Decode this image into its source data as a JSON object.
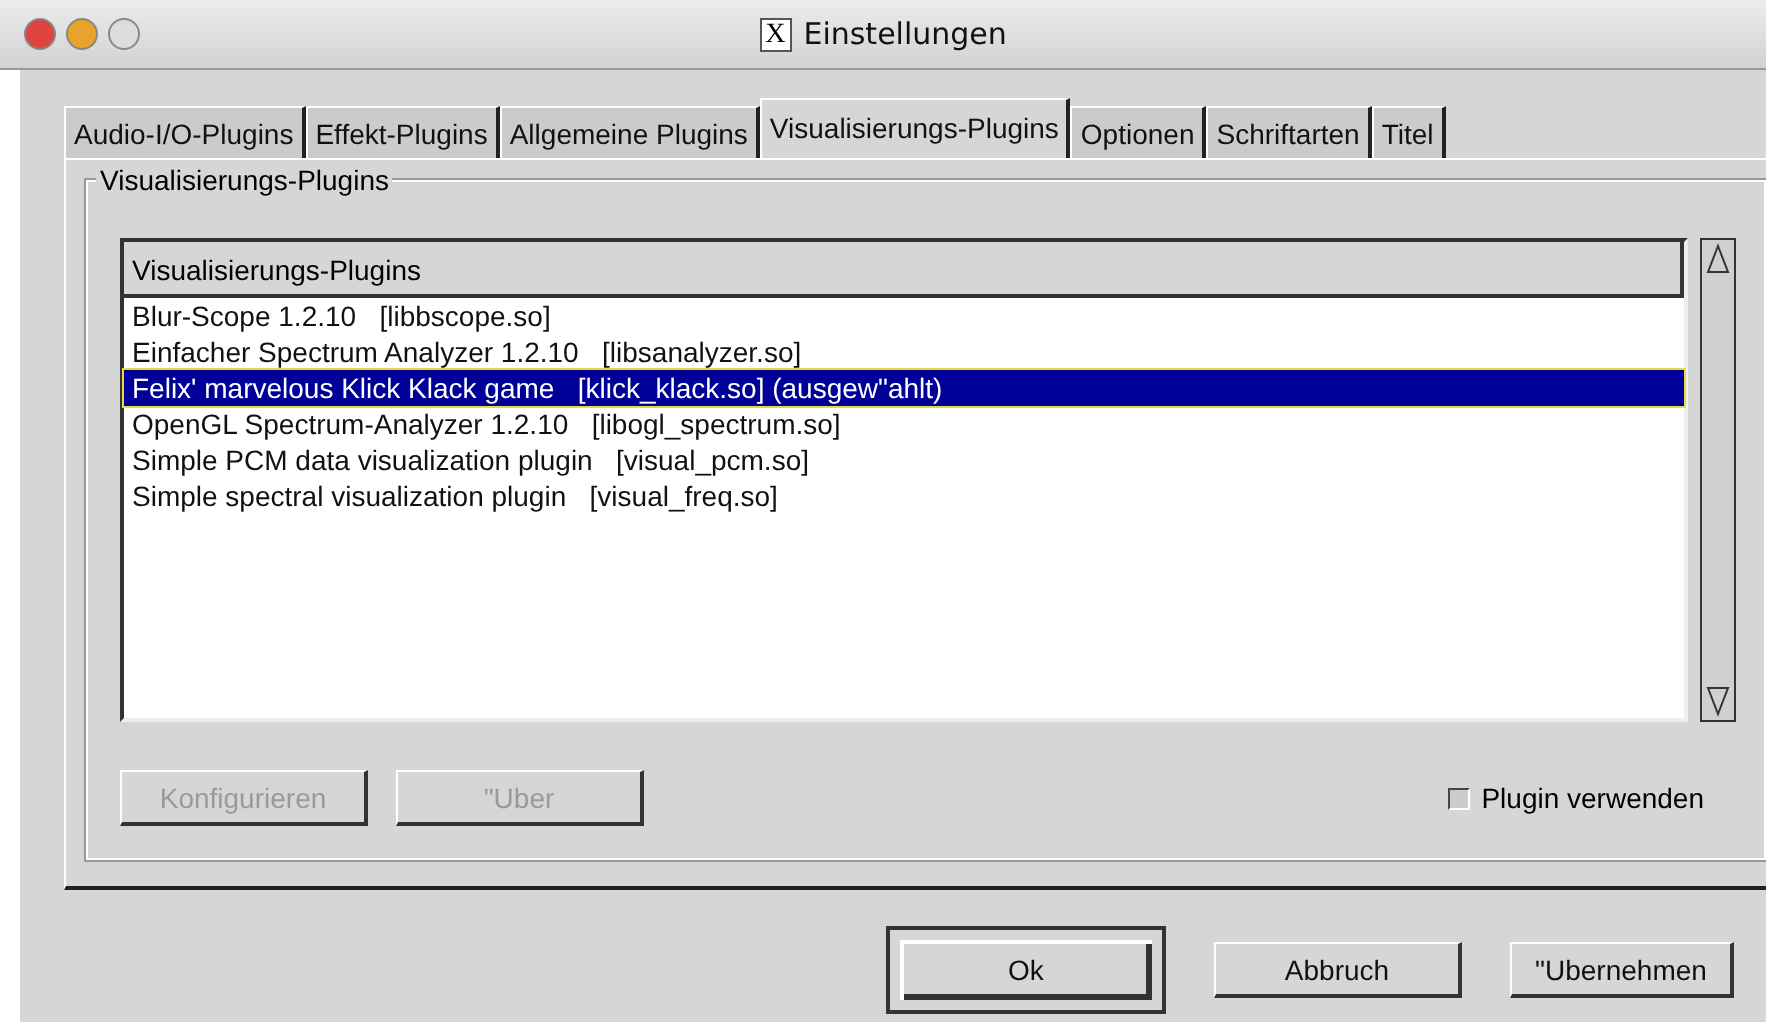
{
  "window": {
    "title": "Einstellungen",
    "title_glyph": "X"
  },
  "tabs": [
    {
      "label": "Audio-I/O-Plugins",
      "selected": false
    },
    {
      "label": "Effekt-Plugins",
      "selected": false
    },
    {
      "label": "Allgemeine Plugins",
      "selected": false
    },
    {
      "label": "Visualisierungs-Plugins",
      "selected": true
    },
    {
      "label": "Optionen",
      "selected": false
    },
    {
      "label": "Schriftarten",
      "selected": false
    },
    {
      "label": "Titel",
      "selected": false
    }
  ],
  "group": {
    "title": "Visualisierungs-Plugins"
  },
  "list": {
    "column": "Visualisierungs-Plugins",
    "rows": [
      {
        "text": "Blur-Scope 1.2.10   [libbscope.so]",
        "selected": false
      },
      {
        "text": "Einfacher Spectrum Analyzer 1.2.10   [libsanalyzer.so]",
        "selected": false
      },
      {
        "text": "Felix' marvelous Klick Klack game   [klick_klack.so] (ausgew\"ahlt)",
        "selected": true
      },
      {
        "text": "OpenGL Spectrum-Analyzer 1.2.10   [libogl_spectrum.so]",
        "selected": false
      },
      {
        "text": "Simple PCM data visualization plugin   [visual_pcm.so]",
        "selected": false
      },
      {
        "text": "Simple spectral visualization plugin   [visual_freq.so]",
        "selected": false
      }
    ]
  },
  "plugin_buttons": [
    {
      "label": "Konfigurieren",
      "disabled": true
    },
    {
      "label": "\"Uber",
      "disabled": true
    }
  ],
  "use_plugin": {
    "label": "Plugin verwenden",
    "checked": false
  },
  "dialog_buttons": [
    {
      "label": "Ok",
      "default": true
    },
    {
      "label": "Abbruch",
      "default": false
    },
    {
      "label": "\"Ubernehmen",
      "default": false
    }
  ]
}
